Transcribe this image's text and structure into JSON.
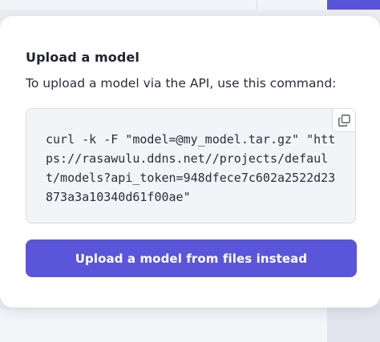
{
  "modal": {
    "title": "Upload a model",
    "description": "To upload a model via the API, use this command:",
    "command": "curl -k -F \"model=@my_model.tar.gz\" \"https://rasawulu.ddns.net//projects/default/models?api_token=948dfece7c602a2522d23873a3a10340d61f00ae\"",
    "copy_icon": "copy-icon",
    "upload_button_label": "Upload a model from files instead"
  },
  "colors": {
    "accent": "#5b55d9",
    "code_background": "#f3f4f8",
    "page_background": "#eceef4"
  }
}
